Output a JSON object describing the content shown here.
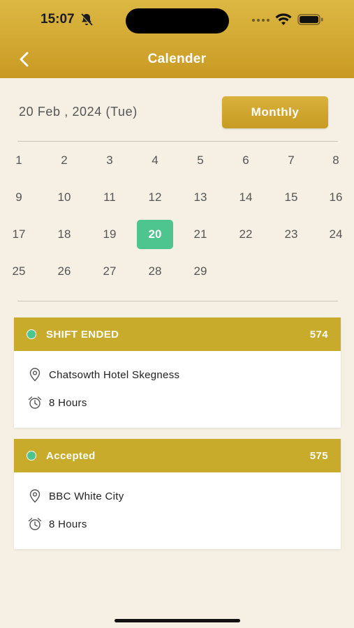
{
  "status_bar": {
    "time": "15:07"
  },
  "header": {
    "title": "Calender"
  },
  "calendar": {
    "selected_date_label": "20  Feb , 2024 (Tue)",
    "view_toggle_label": "Monthly",
    "selected_day": "20",
    "days": [
      "1",
      "2",
      "3",
      "4",
      "5",
      "6",
      "7",
      "8",
      "9",
      "10",
      "11",
      "12",
      "13",
      "14",
      "15",
      "16",
      "17",
      "18",
      "19",
      "20",
      "21",
      "22",
      "23",
      "24",
      "25",
      "26",
      "27",
      "28",
      "29"
    ]
  },
  "shifts": [
    {
      "status": "SHIFT ENDED",
      "id": "574",
      "location": "Chatsowth Hotel Skegness",
      "duration": "8 Hours"
    },
    {
      "status": "Accepted",
      "id": "575",
      "location": "BBC White City",
      "duration": "8 Hours"
    }
  ],
  "colors": {
    "accent": "#c9ab2c",
    "selected": "#4ec48e",
    "background": "#f5f0e3"
  }
}
